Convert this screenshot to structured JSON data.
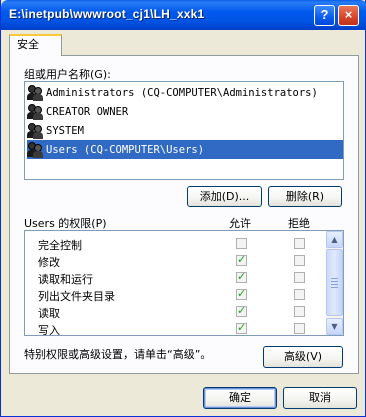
{
  "window": {
    "title": "E:\\inetpub\\wwwroot_cj1\\LH_xxk1",
    "help_label": "?",
    "close_label": "×"
  },
  "tabs": [
    {
      "label": "安全"
    }
  ],
  "users_section": {
    "label": "组或用户名称(G):",
    "items": [
      {
        "name": "Administrators (CQ-COMPUTER\\Administrators)",
        "selected": false
      },
      {
        "name": "CREATOR OWNER",
        "selected": false
      },
      {
        "name": "SYSTEM",
        "selected": false
      },
      {
        "name": "Users (CQ-COMPUTER\\Users)",
        "selected": true
      }
    ],
    "add_button": "添加(D)...",
    "remove_button": "删除(R)"
  },
  "permissions_section": {
    "label": "Users 的权限(P)",
    "allow_header": "允许",
    "deny_header": "拒绝",
    "rows": [
      {
        "name": "完全控制",
        "allow": false,
        "deny": false
      },
      {
        "name": "修改",
        "allow": true,
        "deny": false
      },
      {
        "name": "读取和运行",
        "allow": true,
        "deny": false
      },
      {
        "name": "列出文件夹目录",
        "allow": true,
        "deny": false
      },
      {
        "name": "读取",
        "allow": true,
        "deny": false
      },
      {
        "name": "写入",
        "allow": true,
        "deny": false
      }
    ]
  },
  "advanced": {
    "hint": "特别权限或高级设置，请单击“高级”。",
    "button": "高级(V)"
  },
  "footer": {
    "ok": "确定",
    "cancel": "取消"
  },
  "colors": {
    "titlebar": "#0054e3",
    "selection": "#316ac5",
    "check": "#21a121"
  }
}
